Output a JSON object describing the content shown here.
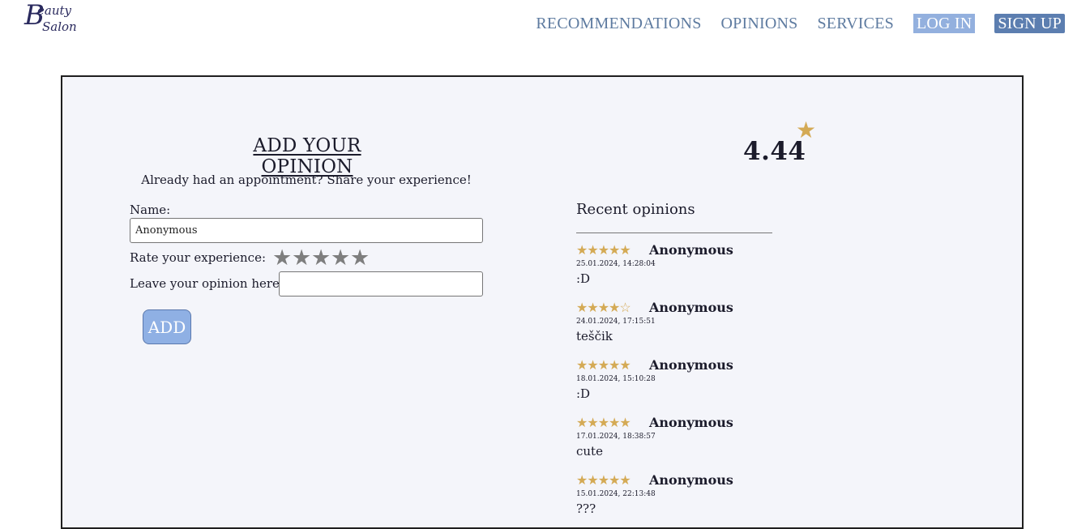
{
  "logo": {
    "initial": "B",
    "word1": "eauty",
    "word2": "Salon"
  },
  "nav": {
    "recommendations": "RECOMMENDATIONS",
    "opinions": "OPINIONS",
    "services": "SERVICES",
    "login": "LOG IN",
    "signup": "SIGN UP"
  },
  "colors": {
    "accent": "#93b0de",
    "accent_dark": "#5c7eb0",
    "star": "#d4aa55",
    "panel_bg": "#f4f5fa"
  },
  "form": {
    "title": "ADD YOUR OPINION",
    "subtitle": "Already had an appointment? Share your experience!",
    "name_label": "Name:",
    "name_value": "Anonymous",
    "rate_label": "Rate your experience:",
    "rating_stars": [
      "★",
      "★",
      "★",
      "★",
      "★"
    ],
    "opinion_label": "Leave your opinion here:",
    "opinion_value": "",
    "add_button": "ADD"
  },
  "summary": {
    "average": "4.44",
    "star_icon": "★"
  },
  "recent": {
    "title": "Recent opinions",
    "items": [
      {
        "stars": "★★★★★",
        "rating": 5,
        "name": "Anonymous",
        "date": "25.01.2024, 14:28:04",
        "text": ":D"
      },
      {
        "stars": "★★★★☆",
        "rating": 4,
        "name": "Anonymous",
        "date": "24.01.2024, 17:15:51",
        "text": "teščik"
      },
      {
        "stars": "★★★★★",
        "rating": 5,
        "name": "Anonymous",
        "date": "18.01.2024, 15:10:28",
        "text": ":D"
      },
      {
        "stars": "★★★★★",
        "rating": 5,
        "name": "Anonymous",
        "date": "17.01.2024, 18:38:57",
        "text": "cute"
      },
      {
        "stars": "★★★★★",
        "rating": 5,
        "name": "Anonymous",
        "date": "15.01.2024, 22:13:48",
        "text": "???"
      }
    ]
  }
}
